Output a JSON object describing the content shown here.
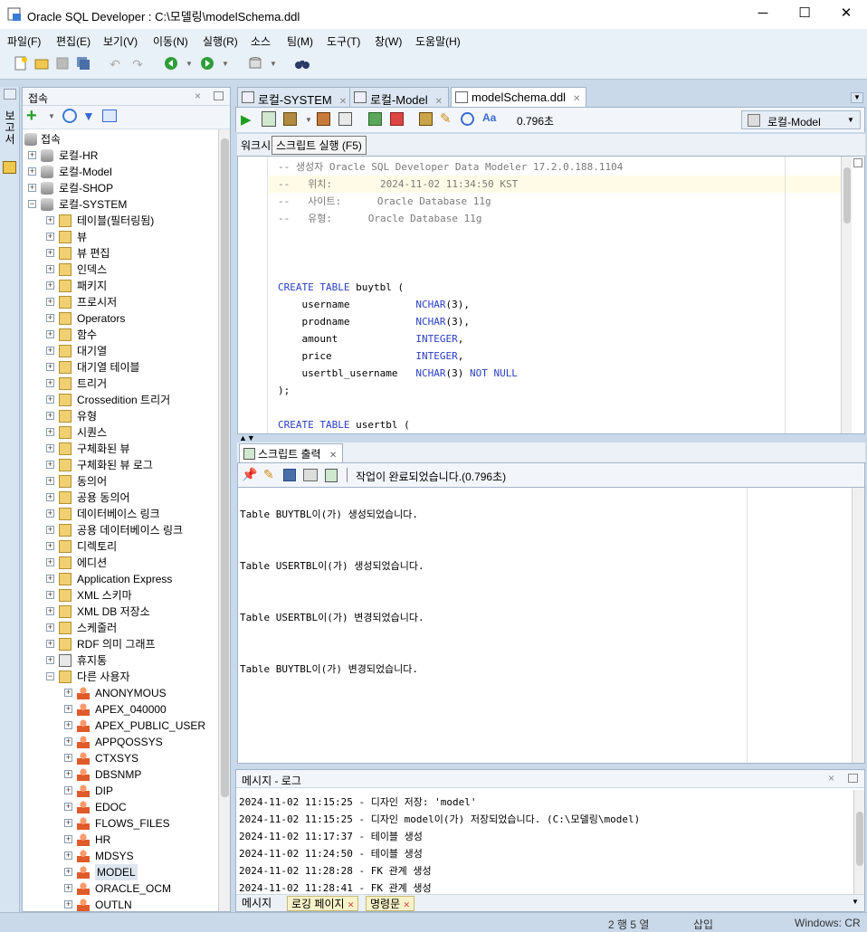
{
  "window": {
    "title": "Oracle SQL Developer : C:\\모델링\\modelSchema.ddl",
    "minimize": "─",
    "maximize": "☐",
    "close": "✕"
  },
  "menu": [
    "파일(F)",
    "편집(E)",
    "보기(V)",
    "이동(N)",
    "실행(R)",
    "소스",
    "팀(M)",
    "도구(T)",
    "창(W)",
    "도움말(H)"
  ],
  "left_strip_label": "보고서",
  "connections": {
    "title": "접속",
    "root": "접속",
    "items": [
      {
        "label": "로컬-HR",
        "level": 1,
        "icon": "db-icon",
        "exp": "+"
      },
      {
        "label": "로컬-Model",
        "level": 1,
        "icon": "db-icon",
        "exp": "+"
      },
      {
        "label": "로컬-SHOP",
        "level": 1,
        "icon": "db-icon",
        "exp": "+"
      },
      {
        "label": "로컬-SYSTEM",
        "level": 1,
        "icon": "db-icon",
        "exp": "−"
      },
      {
        "label": "테이블(필터링됨)",
        "level": 2,
        "icon": "folder-icon",
        "exp": "+"
      },
      {
        "label": "뷰",
        "level": 2,
        "icon": "folder-icon",
        "exp": "+"
      },
      {
        "label": "뷰 편집",
        "level": 2,
        "icon": "folder-icon",
        "exp": "+"
      },
      {
        "label": "인덱스",
        "level": 2,
        "icon": "folder-icon",
        "exp": "+"
      },
      {
        "label": "패키지",
        "level": 2,
        "icon": "folder-icon",
        "exp": "+"
      },
      {
        "label": "프로시저",
        "level": 2,
        "icon": "folder-icon",
        "exp": "+"
      },
      {
        "label": "Operators",
        "level": 2,
        "icon": "folder-icon",
        "exp": "+"
      },
      {
        "label": "함수",
        "level": 2,
        "icon": "folder-icon",
        "exp": "+"
      },
      {
        "label": "대기열",
        "level": 2,
        "icon": "folder-icon",
        "exp": "+"
      },
      {
        "label": "대기열 테이블",
        "level": 2,
        "icon": "folder-icon",
        "exp": "+"
      },
      {
        "label": "트리거",
        "level": 2,
        "icon": "folder-icon",
        "exp": "+"
      },
      {
        "label": "Crossedition 트리거",
        "level": 2,
        "icon": "folder-icon",
        "exp": "+"
      },
      {
        "label": "유형",
        "level": 2,
        "icon": "folder-icon",
        "exp": "+"
      },
      {
        "label": "시퀀스",
        "level": 2,
        "icon": "folder-icon",
        "exp": "+"
      },
      {
        "label": "구체화된 뷰",
        "level": 2,
        "icon": "folder-icon",
        "exp": "+"
      },
      {
        "label": "구체화된 뷰 로그",
        "level": 2,
        "icon": "folder-icon",
        "exp": "+"
      },
      {
        "label": "동의어",
        "level": 2,
        "icon": "folder-icon",
        "exp": "+"
      },
      {
        "label": "공용 동의어",
        "level": 2,
        "icon": "folder-icon",
        "exp": "+"
      },
      {
        "label": "데이터베이스 링크",
        "level": 2,
        "icon": "folder-icon",
        "exp": "+"
      },
      {
        "label": "공용 데이터베이스 링크",
        "level": 2,
        "icon": "folder-icon",
        "exp": "+"
      },
      {
        "label": "디렉토리",
        "level": 2,
        "icon": "folder-icon",
        "exp": "+"
      },
      {
        "label": "에디션",
        "level": 2,
        "icon": "folder-icon",
        "exp": "+"
      },
      {
        "label": "Application Express",
        "level": 2,
        "icon": "folder-icon",
        "exp": "+"
      },
      {
        "label": "XML 스키마",
        "level": 2,
        "icon": "folder-icon",
        "exp": "+"
      },
      {
        "label": "XML DB 저장소",
        "level": 2,
        "icon": "folder-icon",
        "exp": "+"
      },
      {
        "label": "스케줄러",
        "level": 2,
        "icon": "folder-icon",
        "exp": "+"
      },
      {
        "label": "RDF 의미 그래프",
        "level": 2,
        "icon": "folder-icon",
        "exp": "+"
      },
      {
        "label": "휴지통",
        "level": 2,
        "icon": "trash-icon",
        "exp": "+"
      },
      {
        "label": "다른 사용자",
        "level": 2,
        "icon": "folder-icon",
        "exp": "−"
      },
      {
        "label": "ANONYMOUS",
        "level": 3,
        "icon": "user-icon",
        "exp": "+"
      },
      {
        "label": "APEX_040000",
        "level": 3,
        "icon": "user-icon",
        "exp": "+"
      },
      {
        "label": "APEX_PUBLIC_USER",
        "level": 3,
        "icon": "user-icon",
        "exp": "+"
      },
      {
        "label": "APPQOSSYS",
        "level": 3,
        "icon": "user-icon",
        "exp": "+"
      },
      {
        "label": "CTXSYS",
        "level": 3,
        "icon": "user-icon",
        "exp": "+"
      },
      {
        "label": "DBSNMP",
        "level": 3,
        "icon": "user-icon",
        "exp": "+"
      },
      {
        "label": "DIP",
        "level": 3,
        "icon": "user-icon",
        "exp": "+"
      },
      {
        "label": "EDOC",
        "level": 3,
        "icon": "user-icon",
        "exp": "+"
      },
      {
        "label": "FLOWS_FILES",
        "level": 3,
        "icon": "user-icon",
        "exp": "+"
      },
      {
        "label": "HR",
        "level": 3,
        "icon": "user-icon",
        "exp": "+"
      },
      {
        "label": "MDSYS",
        "level": 3,
        "icon": "user-icon",
        "exp": "+"
      },
      {
        "label": "MODEL",
        "level": 3,
        "icon": "user-icon",
        "exp": "+",
        "selected": true
      },
      {
        "label": "ORACLE_OCM",
        "level": 3,
        "icon": "user-icon",
        "exp": "+"
      },
      {
        "label": "OUTLN",
        "level": 3,
        "icon": "user-icon",
        "exp": "+"
      }
    ]
  },
  "editor_tabs": [
    {
      "label": "로컬-SYSTEM",
      "active": false
    },
    {
      "label": "로컬-Model",
      "active": false
    },
    {
      "label": "modelSchema.ddl",
      "active": true
    }
  ],
  "editor_toolbar": {
    "elapsed": "0.796초",
    "connection": "로컬-Model"
  },
  "worksheet_tab": "워크시",
  "tooltip": "스크립트 실행 (F5)",
  "code_lines": [
    [
      {
        "t": "-- 생성자 Oracle SQL Developer Data Modeler 17.2.0.188.1104",
        "c": "cm"
      }
    ],
    [
      {
        "t": "--   위치:        2024-11-02 11:34:50 KST",
        "c": "cm"
      }
    ],
    [
      {
        "t": "--   사이트:      Oracle Database 11g",
        "c": "cm"
      }
    ],
    [
      {
        "t": "--   유형:      Oracle Database 11g",
        "c": "cm"
      }
    ],
    [],
    [],
    [],
    [
      {
        "t": "CREATE TABLE",
        "c": "kw"
      },
      {
        "t": " buytbl (",
        "c": ""
      }
    ],
    [
      {
        "t": "    username           ",
        "c": ""
      },
      {
        "t": "NCHAR",
        "c": "kw"
      },
      {
        "t": "(3),",
        "c": ""
      }
    ],
    [
      {
        "t": "    prodname           ",
        "c": ""
      },
      {
        "t": "NCHAR",
        "c": "kw"
      },
      {
        "t": "(3),",
        "c": ""
      }
    ],
    [
      {
        "t": "    amount             ",
        "c": ""
      },
      {
        "t": "INTEGER",
        "c": "kw"
      },
      {
        "t": ",",
        "c": ""
      }
    ],
    [
      {
        "t": "    price              ",
        "c": ""
      },
      {
        "t": "INTEGER",
        "c": "kw"
      },
      {
        "t": ",",
        "c": ""
      }
    ],
    [
      {
        "t": "    usertbl_username   ",
        "c": ""
      },
      {
        "t": "NCHAR",
        "c": "kw"
      },
      {
        "t": "(3) ",
        "c": ""
      },
      {
        "t": "NOT NULL",
        "c": "kw"
      }
    ],
    [
      {
        "t": ");",
        "c": ""
      }
    ],
    [],
    [
      {
        "t": "CREATE TABLE",
        "c": "kw"
      },
      {
        "t": " usertbl (",
        "c": ""
      }
    ]
  ],
  "script_output": {
    "tab": "스크립트 출력",
    "status": "작업이 완료되었습니다.(0.796초)",
    "lines": [
      "Table BUYTBL이(가) 생성되었습니다.",
      "Table USERTBL이(가) 생성되었습니다.",
      "Table USERTBL이(가) 변경되었습니다.",
      "Table BUYTBL이(가) 변경되었습니다."
    ]
  },
  "message_log": {
    "title": "메시지 - 로그",
    "lines": [
      "2024-11-02 11:15:25 - 디자인 저장: 'model'",
      "2024-11-02 11:15:25 - 디자인 model이(가) 저장되었습니다. (C:\\모델링\\model)",
      "2024-11-02 11:17:37 - 테이블 생성",
      "2024-11-02 11:24:50 - 테이블 생성",
      "2024-11-02 11:28:28 - FK 관계 생성",
      "2024-11-02 11:28:41 - FK 관계 생성"
    ],
    "tabs": [
      {
        "label": "메시지",
        "active": false
      },
      {
        "label": "로깅 페이지",
        "active": true
      },
      {
        "label": "명령문",
        "active": true
      }
    ]
  },
  "status": {
    "position": "2 행 5 열",
    "mode": "삽입",
    "line_ending": "Windows: CR"
  },
  "colors": {
    "keyword": "#2a3fc4",
    "comment": "#7a7a7a",
    "chrome": "#c9d9ea"
  }
}
